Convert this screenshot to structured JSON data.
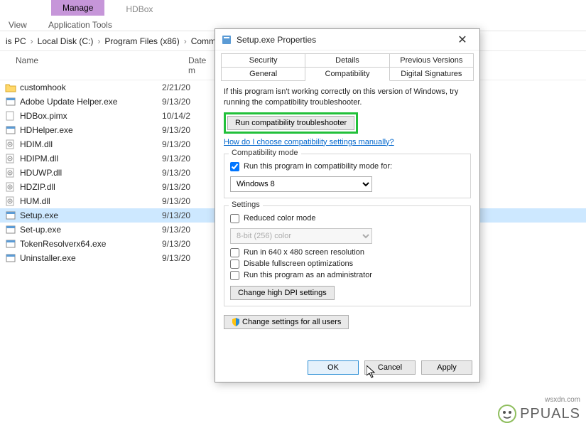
{
  "ribbon": {
    "manage": "Manage",
    "title": "HDBox",
    "view": "View",
    "app_tools": "Application Tools"
  },
  "breadcrumb": {
    "items": [
      "is PC",
      "Local Disk (C:)",
      "Program Files (x86)",
      "Common"
    ]
  },
  "columns": {
    "name": "Name",
    "date": "Date m"
  },
  "files": [
    {
      "icon": "folder",
      "name": "customhook",
      "date": "2/21/20"
    },
    {
      "icon": "exe",
      "name": "Adobe Update Helper.exe",
      "date": "9/13/20"
    },
    {
      "icon": "pimx",
      "name": "HDBox.pimx",
      "date": "10/14/2"
    },
    {
      "icon": "exe",
      "name": "HDHelper.exe",
      "date": "9/13/20"
    },
    {
      "icon": "dll",
      "name": "HDIM.dll",
      "date": "9/13/20"
    },
    {
      "icon": "dll",
      "name": "HDIPM.dll",
      "date": "9/13/20"
    },
    {
      "icon": "dll",
      "name": "HDUWP.dll",
      "date": "9/13/20"
    },
    {
      "icon": "dll",
      "name": "HDZIP.dll",
      "date": "9/13/20"
    },
    {
      "icon": "dll",
      "name": "HUM.dll",
      "date": "9/13/20"
    },
    {
      "icon": "exe",
      "name": "Setup.exe",
      "date": "9/13/20",
      "selected": true
    },
    {
      "icon": "exe",
      "name": "Set-up.exe",
      "date": "9/13/20"
    },
    {
      "icon": "exe",
      "name": "TokenResolverx64.exe",
      "date": "9/13/20"
    },
    {
      "icon": "exe",
      "name": "Uninstaller.exe",
      "date": "9/13/20"
    }
  ],
  "dialog": {
    "title": "Setup.exe Properties",
    "tabs_top": [
      "Security",
      "Details",
      "Previous Versions"
    ],
    "tabs_bottom": [
      "General",
      "Compatibility",
      "Digital Signatures"
    ],
    "active_tab": "Compatibility",
    "intro": "If this program isn't working correctly on this version of Windows, try running the compatibility troubleshooter.",
    "run_compat": "Run compatibility troubleshooter",
    "link": "How do I choose compatibility settings manually?",
    "compat_mode": {
      "legend": "Compatibility mode",
      "label": "Run this program in compatibility mode for:",
      "checked": true,
      "selected": "Windows 8"
    },
    "settings": {
      "legend": "Settings",
      "reduced_color": "Reduced color mode",
      "color_select": "8-bit (256) color",
      "run_640": "Run in 640 x 480 screen resolution",
      "disable_fullscreen": "Disable fullscreen optimizations",
      "run_admin": "Run this program as an administrator",
      "change_dpi": "Change high DPI settings"
    },
    "change_all": "Change settings for all users",
    "ok": "OK",
    "cancel": "Cancel",
    "apply": "Apply"
  },
  "watermark": {
    "text": "PPUALS",
    "url": "wsxdn.com"
  }
}
